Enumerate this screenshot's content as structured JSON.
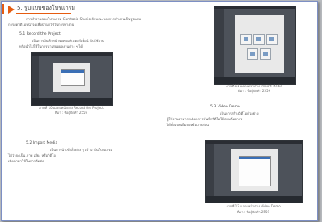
{
  "section": {
    "title": "5. รูปแบบของโปรแกรม"
  },
  "intro": {
    "line1": "การทำงานของโปรแกรม Camtasia Studio ลักษณะของการทำงานเป็นรูปแบบ",
    "line2": "การอัดวิดีโอหน้าจอเพื่อนำมาใช้ในการทำงาน"
  },
  "item1": {
    "title": "5.1 Record the Project",
    "line1": "เป็นการบันทึกหน้าจอคอมพิวเตอร์เพื่อนำไปใช้งาน",
    "line2": "หรือนำไปใช้ในการนำเสนอผลงานต่าง ๆ ได้"
  },
  "fig1": {
    "caption": "ภาพที่ 10 แสดงหน้าต่าง Record the Project",
    "source": "ที่มา : ชื่อผู้จัดทำ 2559"
  },
  "item2": {
    "title": "5.2 Import Media",
    "line1": "เป็นการนำเข้าสื่อต่าง ๆ เข้ามาในโปรแกรม",
    "line2": "ไม่ว่าจะเป็น ภาพ เสียง หรือวิดีโอ",
    "line3": "เพื่อนำมาใช้ในการตัดต่อ"
  },
  "fig2": {
    "caption": "ภาพที่ 11 แสดงหน้าต่าง Import Media",
    "source": "ที่มา : ชื่อผู้จัดทำ 2559"
  },
  "item3": {
    "title": "5.3 Video Demo",
    "line1": "เป็นการสร้างวิดีโอตัวอย่าง",
    "line2": "ผู้ใช้งานสามารถเลือกการบันทึกวิดีโอได้ตามต้องการ",
    "line3": "ได้ทั้งแบบเต็มจอหรือบางส่วน"
  },
  "fig3": {
    "caption": "ภาพที่ 12 แสดงหน้าต่าง Video Demo",
    "source": "ที่มา : ชื่อผู้จัดทำ 2559"
  }
}
